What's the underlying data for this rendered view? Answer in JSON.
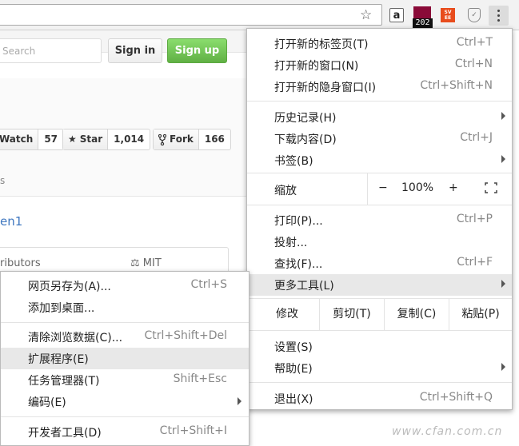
{
  "toolbar": {
    "ext_a": "a",
    "ext_badge": "202",
    "ext_sv_top": "SV",
    "ext_sv_bottom": "EE"
  },
  "github": {
    "search_placeholder": "Search",
    "signin": "Sign in",
    "signup": "Sign up",
    "watch_label": "Watch",
    "watch_count": "57",
    "star_label": "Star",
    "star_count": "1,014",
    "fork_label": "Fork",
    "fork_count": "166",
    "tab_fragment": "s",
    "desc_fragment": "en1",
    "contributors_fragment": "ributors",
    "license": "MIT"
  },
  "menu": {
    "items": [
      {
        "label": "打开新的标签页(T)",
        "shortcut": "Ctrl+T"
      },
      {
        "label": "打开新的窗口(N)",
        "shortcut": "Ctrl+N"
      },
      {
        "label": "打开新的隐身窗口(I)",
        "shortcut": "Ctrl+Shift+N"
      },
      {
        "label": "历史记录(H)",
        "shortcut": ""
      },
      {
        "label": "下载内容(D)",
        "shortcut": "Ctrl+J"
      },
      {
        "label": "书签(B)",
        "shortcut": ""
      },
      {
        "label": "打印(P)...",
        "shortcut": "Ctrl+P"
      },
      {
        "label": "投射...",
        "shortcut": ""
      },
      {
        "label": "查找(F)...",
        "shortcut": "Ctrl+F"
      },
      {
        "label": "更多工具(L)",
        "shortcut": ""
      },
      {
        "label": "设置(S)",
        "shortcut": ""
      },
      {
        "label": "帮助(E)",
        "shortcut": ""
      },
      {
        "label": "退出(X)",
        "shortcut": "Ctrl+Shift+Q"
      }
    ],
    "zoom": {
      "label": "缩放",
      "minus": "−",
      "value": "100%",
      "plus": "+"
    },
    "edit": {
      "label": "修改",
      "cut": "剪切(T)",
      "copy": "复制(C)",
      "paste": "粘贴(P)"
    }
  },
  "submenu": {
    "items": [
      {
        "label": "网页另存为(A)...",
        "shortcut": "Ctrl+S"
      },
      {
        "label": "添加到桌面...",
        "shortcut": ""
      },
      {
        "label": "清除浏览数据(C)...",
        "shortcut": "Ctrl+Shift+Del"
      },
      {
        "label": "扩展程序(E)",
        "shortcut": ""
      },
      {
        "label": "任务管理器(T)",
        "shortcut": "Shift+Esc"
      },
      {
        "label": "编码(E)",
        "shortcut": ""
      },
      {
        "label": "开发者工具(D)",
        "shortcut": "Ctrl+Shift+I"
      }
    ]
  },
  "watermark": "www.cfan.com.cn"
}
